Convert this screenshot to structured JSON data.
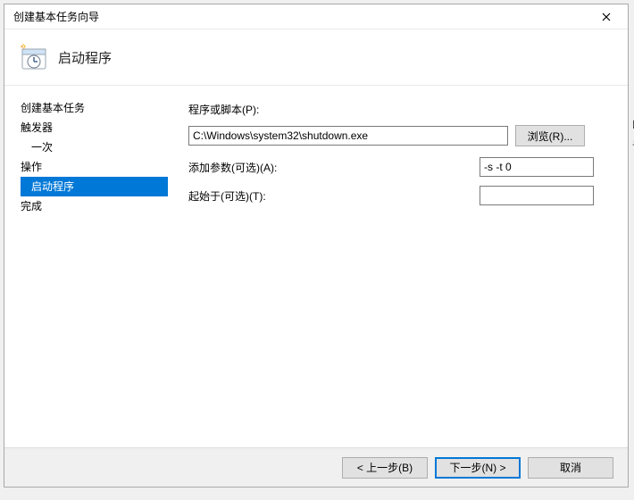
{
  "window": {
    "title": "创建基本任务向导"
  },
  "header": {
    "page_title": "启动程序"
  },
  "sidebar": {
    "items": [
      {
        "label": "创建基本任务"
      },
      {
        "label": "触发器"
      },
      {
        "label": "一次"
      },
      {
        "label": "操作"
      },
      {
        "label": "启动程序"
      },
      {
        "label": "完成"
      }
    ]
  },
  "form": {
    "program_label": "程序或脚本(P):",
    "program_value": "C:\\Windows\\system32\\shutdown.exe",
    "browse_label": "浏览(R)...",
    "args_label": "添加参数(可选)(A):",
    "args_value": "-s -t 0",
    "startin_label": "起始于(可选)(T):",
    "startin_value": ""
  },
  "footer": {
    "back": "< 上一步(B)",
    "next": "下一步(N) >",
    "cancel": "取消"
  },
  "outside": {
    "a": "的",
    "b": "记"
  }
}
